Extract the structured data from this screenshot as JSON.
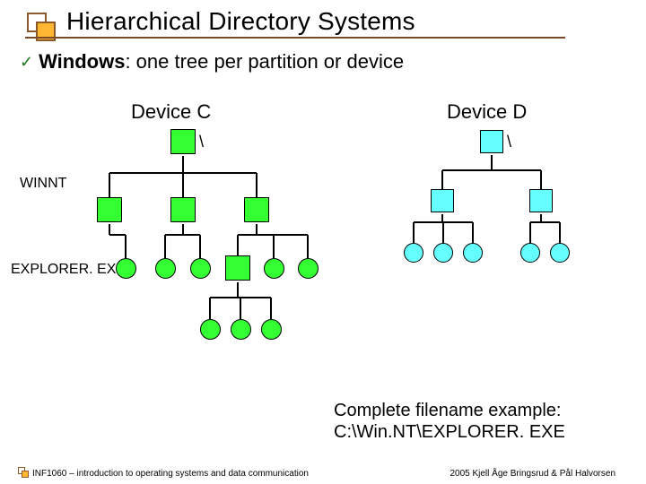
{
  "title": "Hierarchical Directory Systems",
  "bullet": {
    "check": "✓",
    "label_strong": "Windows",
    "label_rest": ": one tree per partition or device"
  },
  "deviceC": {
    "label": "Device C",
    "root": "\\",
    "dir_label": "WINNT",
    "file_label": "EXPLORER. EXE"
  },
  "deviceD": {
    "label": "Device D",
    "root": "\\"
  },
  "example": {
    "line1": "Complete filename example:",
    "line2": "C:\\Win.NT\\EXPLORER. EXE"
  },
  "footer": {
    "left": "INF1060 – introduction to operating systems and data communication",
    "right": "2005  Kjell Åge Bringsrud & Pål Halvorsen"
  }
}
